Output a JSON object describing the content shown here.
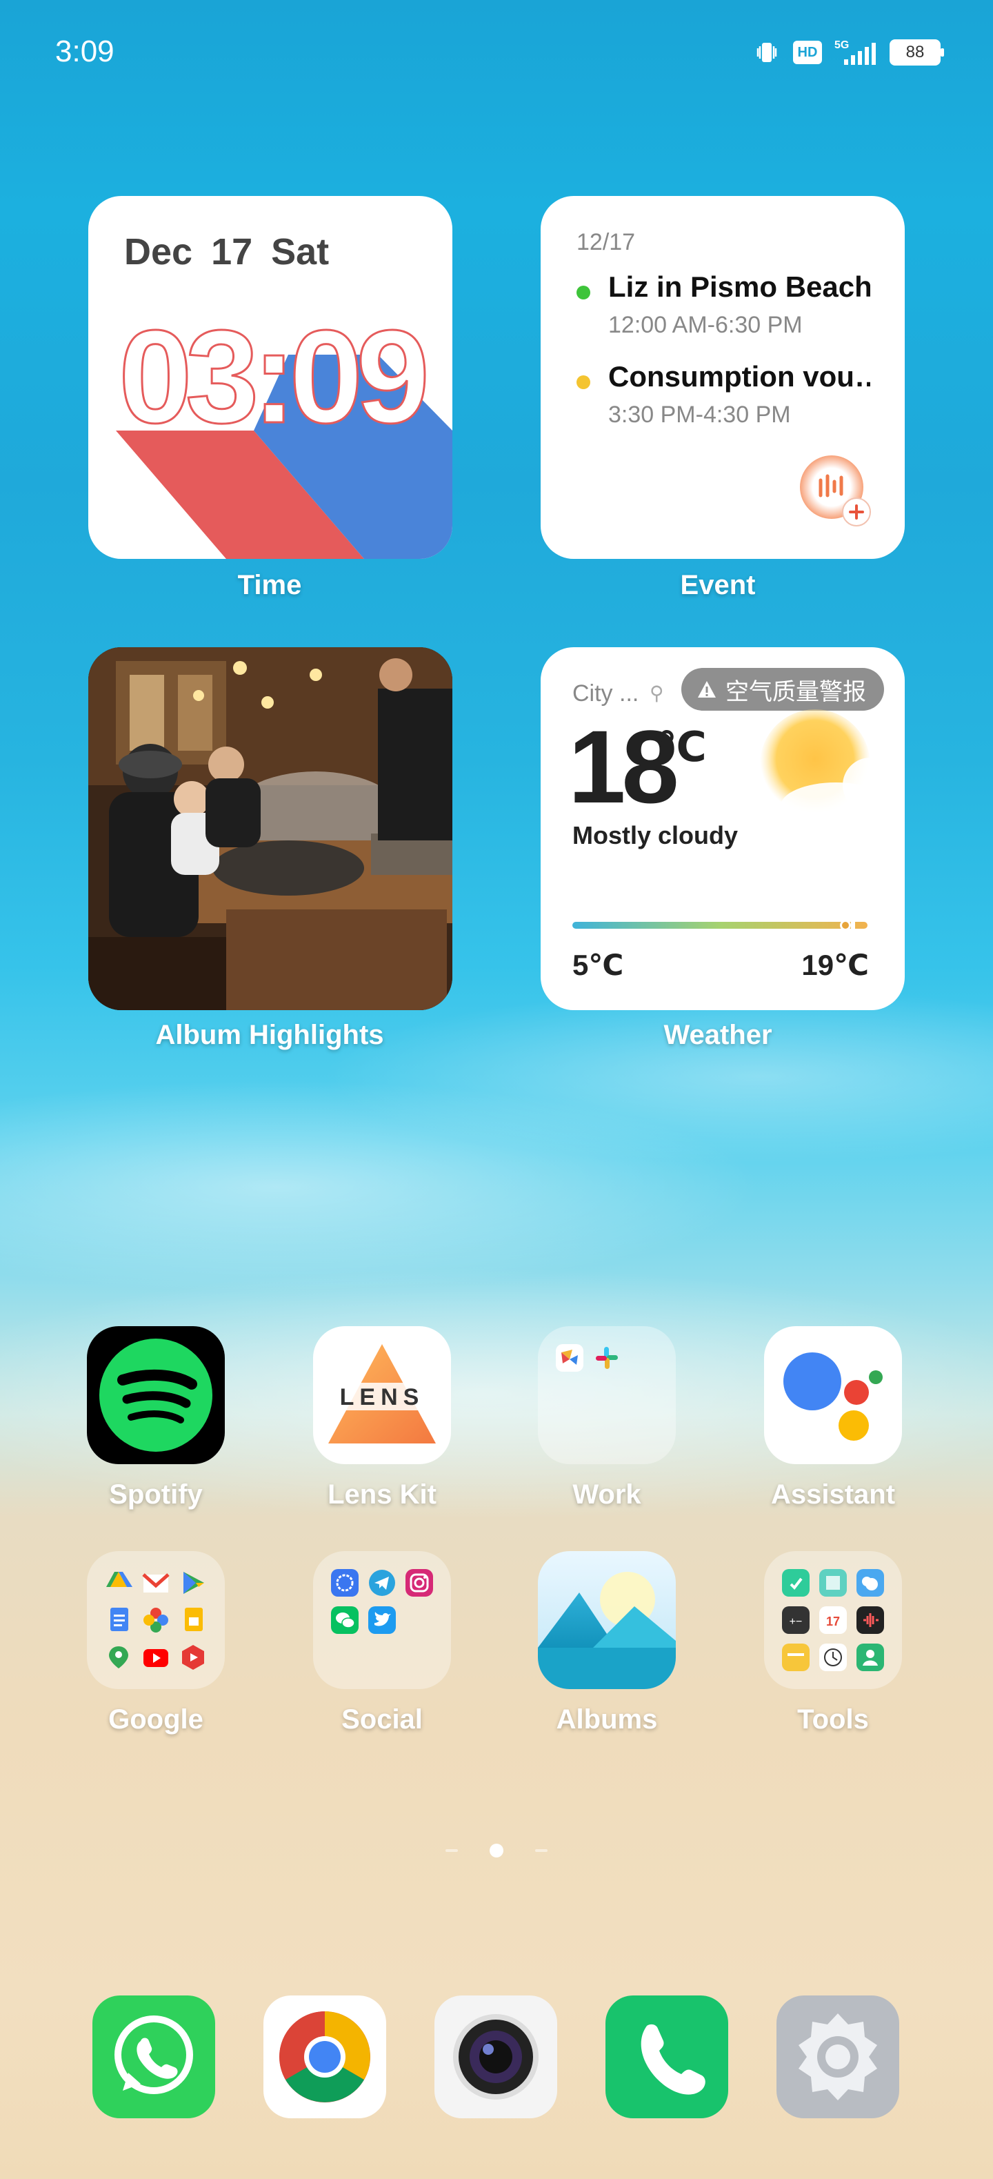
{
  "status_bar": {
    "time": "3:09",
    "battery": "88",
    "network": "5G",
    "hd": "HD"
  },
  "widgets": {
    "time": {
      "date": "Dec 17  Sat",
      "clock": "03:09",
      "label": "Time"
    },
    "event": {
      "date": "12/17",
      "events": [
        {
          "title": "Liz in Pismo Beach",
          "time": "12:00 AM-6:30 PM",
          "color": "#3ec43a"
        },
        {
          "title": "Consumption vou…",
          "time": "3:30 PM-4:30 PM",
          "color": "#f4c430"
        }
      ],
      "label": "Event"
    },
    "album": {
      "label": "Album Highlights"
    },
    "weather": {
      "city": "City ...",
      "alert": "空气质量警报",
      "temp": "18",
      "unit": "℃",
      "condition": "Mostly cloudy",
      "low": "5℃",
      "high": "19℃",
      "label": "Weather"
    }
  },
  "apps": [
    {
      "name": "Spotify",
      "icon": "spotify-icon"
    },
    {
      "name": "Lens Kit",
      "icon": "lens-kit-icon",
      "text": "LENS"
    },
    {
      "name": "Work",
      "icon": "work-folder-icon"
    },
    {
      "name": "Assistant",
      "icon": "google-assistant-icon"
    },
    {
      "name": "Google",
      "icon": "google-folder-icon"
    },
    {
      "name": "Social",
      "icon": "social-folder-icon"
    },
    {
      "name": "Albums",
      "icon": "albums-icon"
    },
    {
      "name": "Tools",
      "icon": "tools-folder-icon"
    }
  ],
  "dock": [
    {
      "name": "WhatsApp",
      "icon": "whatsapp-icon"
    },
    {
      "name": "Chrome",
      "icon": "chrome-icon"
    },
    {
      "name": "Camera",
      "icon": "camera-icon"
    },
    {
      "name": "Phone",
      "icon": "phone-icon"
    },
    {
      "name": "Settings",
      "icon": "settings-icon"
    }
  ],
  "tools_calendar_day": "17"
}
